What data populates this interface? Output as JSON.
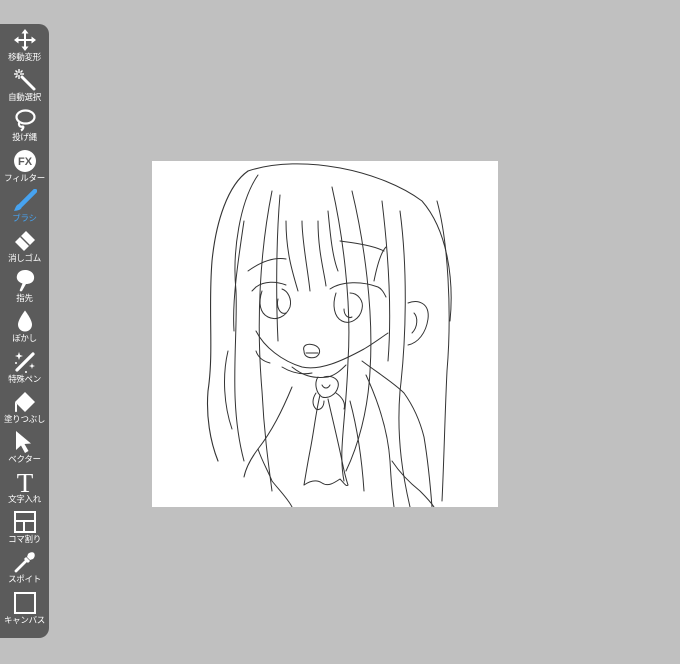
{
  "toolbar": {
    "tools": [
      {
        "label": "移動変形",
        "icon": "move-icon"
      },
      {
        "label": "自動選択",
        "icon": "magic-wand-icon"
      },
      {
        "label": "投げ縄",
        "icon": "lasso-icon"
      },
      {
        "label": "フィルター",
        "icon": "fx-icon",
        "icon_text": "FX"
      },
      {
        "label": "ブラシ",
        "icon": "brush-icon",
        "active": true
      },
      {
        "label": "消しゴム",
        "icon": "eraser-icon"
      },
      {
        "label": "指先",
        "icon": "smudge-icon"
      },
      {
        "label": "ぼかし",
        "icon": "blur-icon"
      },
      {
        "label": "特殊ペン",
        "icon": "special-pen-icon"
      },
      {
        "label": "塗りつぶし",
        "icon": "fill-bucket-icon"
      },
      {
        "label": "ベクター",
        "icon": "vector-cursor-icon"
      },
      {
        "label": "文字入れ",
        "icon": "text-icon",
        "icon_text": "T"
      },
      {
        "label": "コマ割り",
        "icon": "frame-divider-icon"
      },
      {
        "label": "スポイト",
        "icon": "eyedropper-icon"
      },
      {
        "label": "キャンバス",
        "icon": "canvas-icon"
      }
    ]
  },
  "colors": {
    "toolbar_bg": "#5b5b5b",
    "workspace_bg": "#c0c0c0",
    "active_tool": "#47a3f0",
    "canvas_bg": "#ffffff"
  }
}
